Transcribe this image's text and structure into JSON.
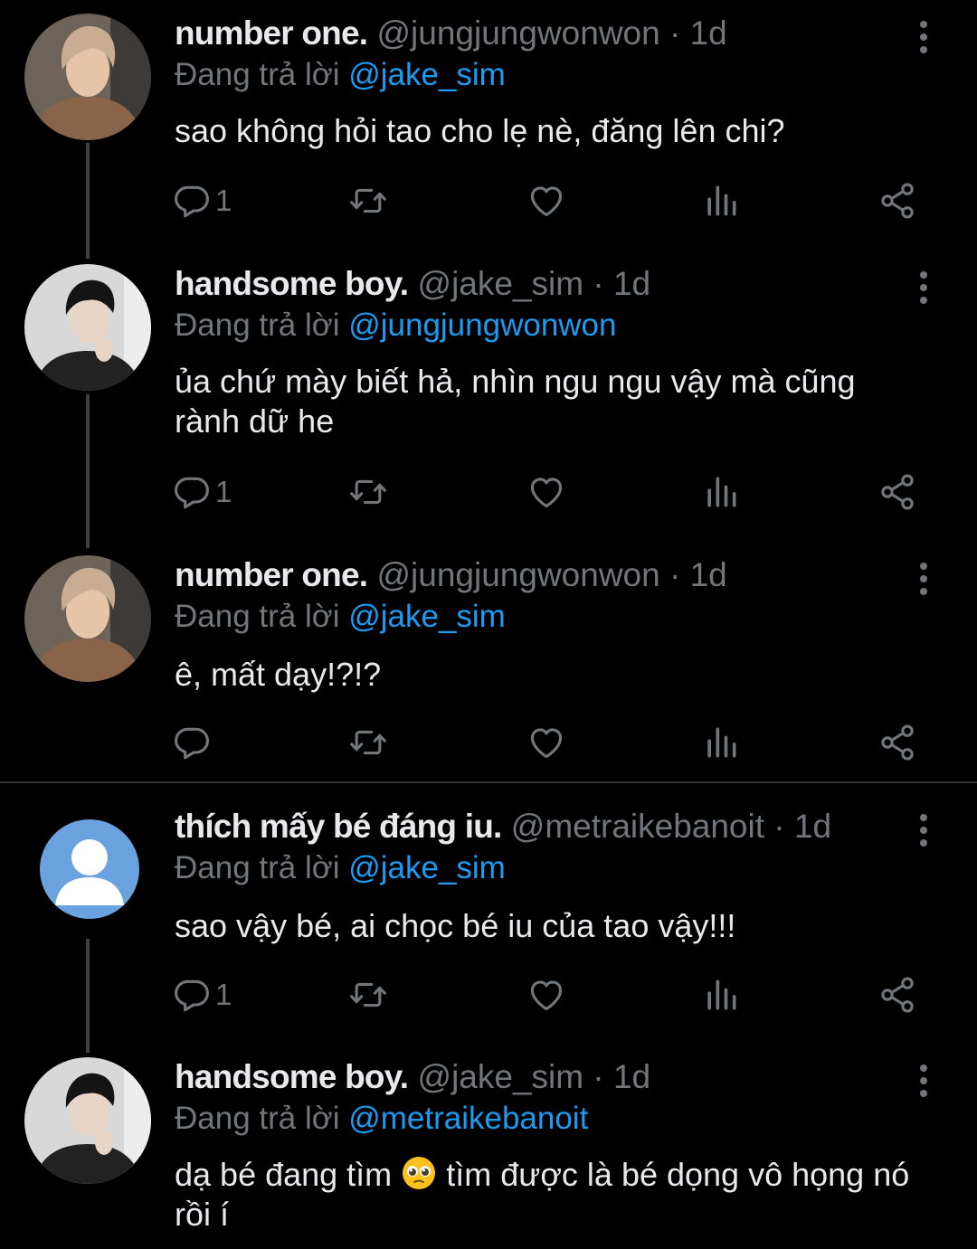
{
  "tweets": [
    {
      "display_name": "number one.",
      "handle": "@jungjungwonwon",
      "time": "· 1d",
      "reply_prefix": "Đang trả lời",
      "reply_to": "@jake_sim",
      "text": "sao không hỏi tao cho lẹ nè, đăng lên chi?",
      "reply_count": "1",
      "avatar_icon": "user-photo-blonde-avatar"
    },
    {
      "display_name": "handsome boy.",
      "handle": "@jake_sim",
      "time": "· 1d",
      "reply_prefix": "Đang trả lời",
      "reply_to": "@jungjungwonwon",
      "text": "ủa chứ mày biết hả, nhìn ngu ngu vậy mà cũng rành dữ he",
      "reply_count": "1",
      "avatar_icon": "user-photo-dark-hair-avatar"
    },
    {
      "display_name": "number one.",
      "handle": "@jungjungwonwon",
      "time": "· 1d",
      "reply_prefix": "Đang trả lời",
      "reply_to": "@jake_sim",
      "text": "ê, mất dạy!?!?",
      "reply_count": "",
      "avatar_icon": "user-photo-blonde-avatar"
    },
    {
      "display_name": "thích mấy bé đáng iu.",
      "handle": "@metraikebanoit",
      "time": "· 1d",
      "reply_prefix": "Đang trả lời",
      "reply_to": "@jake_sim",
      "text": "sao vậy bé, ai chọc bé iu của tao vậy!!!",
      "reply_count": "1",
      "avatar_icon": "default-user-avatar"
    },
    {
      "display_name": "handsome boy.",
      "handle": "@jake_sim",
      "time": "· 1d",
      "reply_prefix": "Đang trả lời",
      "reply_to": "@metraikebanoit",
      "text_before_emoji": "dạ bé đang tìm",
      "emoji": "pleading-face-emoji",
      "text_after_emoji": "tìm được là bé dọng vô họng nó rồi í",
      "avatar_icon": "user-photo-dark-hair-avatar"
    }
  ],
  "colors": {
    "background": "#000000",
    "text": "#e7e9ea",
    "secondary": "#71767b",
    "link": "#1d9bf0",
    "thread_line": "#3e4144"
  },
  "icons": [
    "reply-icon",
    "retweet-icon",
    "like-icon",
    "views-icon",
    "share-icon",
    "more-icon"
  ]
}
